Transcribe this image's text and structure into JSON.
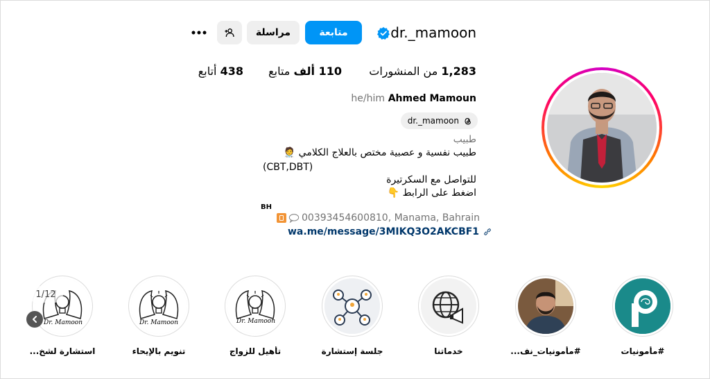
{
  "profile": {
    "username": "dr._mamoon",
    "follow_label": "متابعة",
    "message_label": "مراسلة",
    "full_name": "Ahmed Mamoun",
    "pronouns": "he/him",
    "threads_handle": "dr._mamoon",
    "category": "طبيب"
  },
  "stats": {
    "posts_value": "1,283",
    "posts_label": "من المنشورات",
    "followers_value": "110 ألف",
    "followers_label": "متابع",
    "following_value": "438",
    "following_label": "أتابع"
  },
  "bio": {
    "line1": "طبيب نفسية و عصبية مختص بالعلاج الكلامي 🧑‍⚕️",
    "line2": "(CBT,DBT)",
    "line3": "للتواصل مع السكرتيرة",
    "line4": "اضغط على الرابط 👇",
    "line5": "BH",
    "contact": "00393454600810, Manama, Bahrain",
    "link": "wa.me/message/3MIKQ3O2AKCBF1"
  },
  "highlights": {
    "counter": "1/12",
    "items": [
      {
        "label": "#مأمونيات"
      },
      {
        "label": "#مأمونيات_نف..."
      },
      {
        "label": "خدماتنا"
      },
      {
        "label": "جلسة إستشارة"
      },
      {
        "label": "تأهيل للزواج"
      },
      {
        "label": "تنويم بالإيحاء"
      },
      {
        "label": "استشارة لشخ..."
      }
    ],
    "logo_text": "Dr. Mamoon"
  },
  "colors": {
    "accent": "#0095f6",
    "link": "#00376b",
    "muted": "#737373",
    "button_bg": "#efefef"
  },
  "icons": [
    "verified-badge-icon",
    "add-person-icon",
    "more-icon",
    "threads-icon",
    "link-icon",
    "chevron-left-icon"
  ]
}
